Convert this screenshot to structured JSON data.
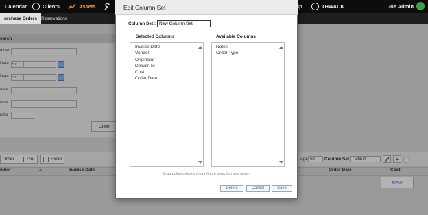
{
  "nav": {
    "items": [
      {
        "label": "Calendar"
      },
      {
        "label": "Clients"
      },
      {
        "label": "Assets"
      },
      {
        "label": "lp"
      },
      {
        "label": "THWACK"
      }
    ],
    "user": "Joe Admin"
  },
  "subnav": {
    "tabs": [
      {
        "label": "urchase Orders"
      },
      {
        "label": "Reservations"
      }
    ]
  },
  "search_panel": {
    "title": "earch",
    "fields": [
      {
        "label": "mber"
      },
      {
        "label": "Date",
        "operator": "= ∨"
      },
      {
        "label": "Date",
        "operator": "= ∨"
      },
      {
        "label": "ame"
      },
      {
        "label": "ame"
      },
      {
        "label": "ndor"
      }
    ],
    "clear_label": "Clear"
  },
  "toolbar": {
    "order_label": "Order",
    "tsv_label": "TSV",
    "excel_label": "Excel",
    "page_label": "age",
    "page_size": "50",
    "column_set_label": "Column Set",
    "column_set_value": "Default"
  },
  "grid": {
    "columns": [
      "mber",
      "Invoice Date",
      "Order Date",
      "Cost"
    ],
    "new_label": "New"
  },
  "dialog": {
    "title": "Edit Column Set",
    "column_set_label": "Column Set :",
    "column_set_value": "New Column Set",
    "selected_heading": "Selected Columns",
    "available_heading": "Available Columns",
    "selected_columns": [
      "Invoice Date",
      "Vendor",
      "Originator",
      "Deliver To",
      "Cost",
      "Order Date"
    ],
    "available_columns": [
      "Notes",
      "Order Type"
    ],
    "hint": "Drag column labels to configure selection and order.",
    "delete_label": "Delete",
    "cancel_label": "Cancel",
    "save_label": "Save"
  },
  "colors": {
    "nav_bg": "#0d0d0d",
    "accent_assets": "#f0a030",
    "link_blue": "#3a6ea5",
    "overlay_grey": "#9a9a9a"
  }
}
